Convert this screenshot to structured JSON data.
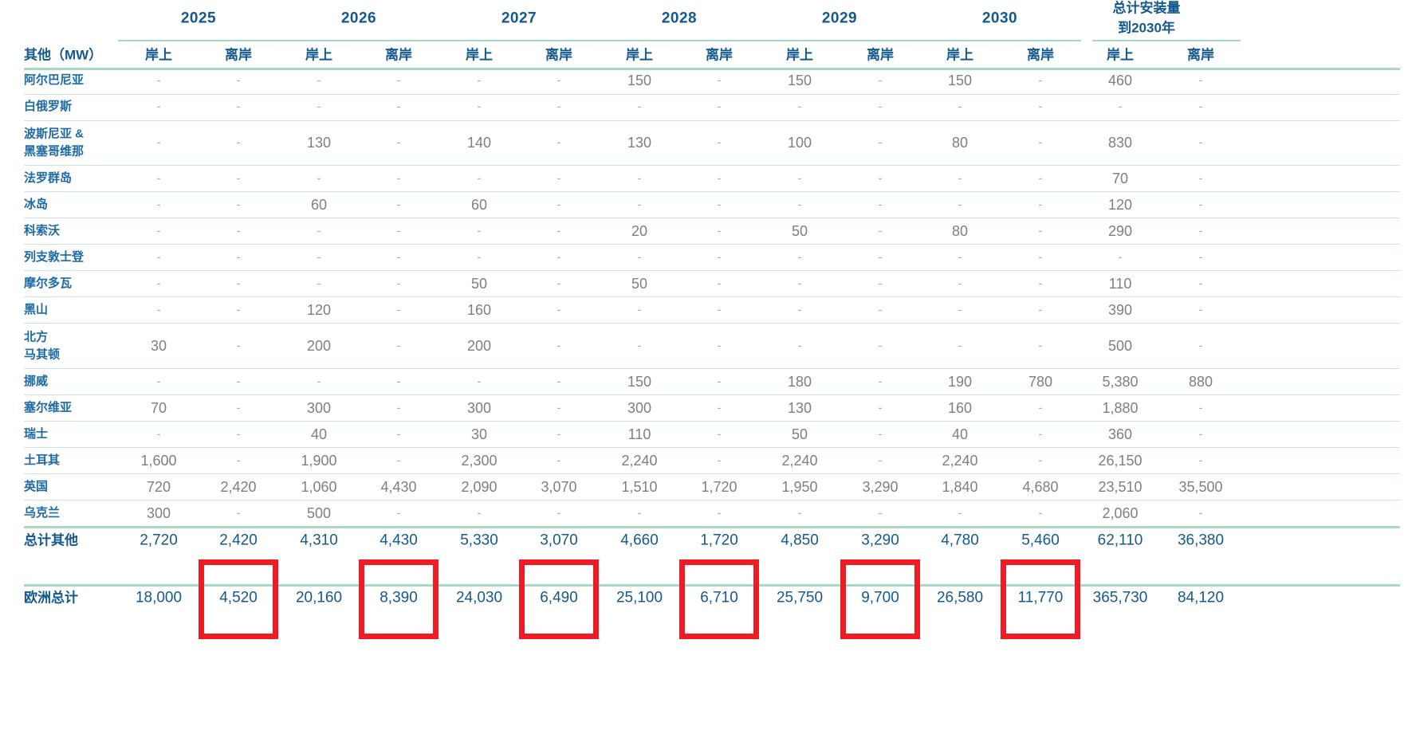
{
  "years": [
    "2025",
    "2026",
    "2027",
    "2028",
    "2029",
    "2030"
  ],
  "total_header": "总计安装量\n到2030年",
  "corner_label": "其他（MW）",
  "subheaders": [
    "岸上",
    "离岸",
    "岸上",
    "离岸",
    "岸上",
    "离岸",
    "岸上",
    "离岸",
    "岸上",
    "离岸",
    "岸上",
    "离岸",
    "岸上",
    "离岸"
  ],
  "rows": [
    {
      "label": "阿尔巴尼亚",
      "values": [
        "-",
        "-",
        "-",
        "-",
        "-",
        "-",
        "150",
        "-",
        "150",
        "-",
        "150",
        "-",
        "460",
        "-"
      ]
    },
    {
      "label": "白俄罗斯",
      "values": [
        "-",
        "-",
        "-",
        "-",
        "-",
        "-",
        "-",
        "-",
        "-",
        "-",
        "-",
        "-",
        "-",
        "-"
      ]
    },
    {
      "label": "波斯尼亚 &\n黑塞哥维那",
      "values": [
        "-",
        "-",
        "130",
        "-",
        "140",
        "-",
        "130",
        "-",
        "100",
        "-",
        "80",
        "-",
        "830",
        "-"
      ]
    },
    {
      "label": "法罗群岛",
      "values": [
        "-",
        "-",
        "-",
        "-",
        "-",
        "-",
        "-",
        "-",
        "-",
        "-",
        "-",
        "-",
        "70",
        "-"
      ]
    },
    {
      "label": "冰岛",
      "values": [
        "-",
        "-",
        "60",
        "-",
        "60",
        "-",
        "-",
        "-",
        "-",
        "-",
        "-",
        "-",
        "120",
        "-"
      ]
    },
    {
      "label": "科索沃",
      "values": [
        "-",
        "-",
        "-",
        "-",
        "-",
        "-",
        "20",
        "-",
        "50",
        "-",
        "80",
        "-",
        "290",
        "-"
      ]
    },
    {
      "label": "列支敦士登",
      "values": [
        "-",
        "-",
        "-",
        "-",
        "-",
        "-",
        "-",
        "-",
        "-",
        "-",
        "-",
        "-",
        "-",
        "-"
      ]
    },
    {
      "label": "摩尔多瓦",
      "values": [
        "-",
        "-",
        "-",
        "-",
        "50",
        "-",
        "50",
        "-",
        "-",
        "-",
        "-",
        "-",
        "110",
        "-"
      ]
    },
    {
      "label": "黑山",
      "values": [
        "-",
        "-",
        "120",
        "-",
        "160",
        "-",
        "-",
        "-",
        "-",
        "-",
        "-",
        "-",
        "390",
        "-"
      ]
    },
    {
      "label": "北方\n马其顿",
      "values": [
        "30",
        "-",
        "200",
        "-",
        "200",
        "-",
        "-",
        "-",
        "-",
        "-",
        "-",
        "-",
        "500",
        "-"
      ]
    },
    {
      "label": "挪威",
      "values": [
        "-",
        "-",
        "-",
        "-",
        "-",
        "-",
        "150",
        "-",
        "180",
        "-",
        "190",
        "780",
        "5,380",
        "880"
      ]
    },
    {
      "label": "塞尔维亚",
      "values": [
        "70",
        "-",
        "300",
        "-",
        "300",
        "-",
        "300",
        "-",
        "130",
        "-",
        "160",
        "-",
        "1,880",
        "-"
      ]
    },
    {
      "label": "瑞士",
      "values": [
        "-",
        "-",
        "40",
        "-",
        "30",
        "-",
        "110",
        "-",
        "50",
        "-",
        "40",
        "-",
        "360",
        "-"
      ]
    },
    {
      "label": "土耳其",
      "values": [
        "1,600",
        "-",
        "1,900",
        "-",
        "2,300",
        "-",
        "2,240",
        "-",
        "2,240",
        "-",
        "2,240",
        "-",
        "26,150",
        "-"
      ]
    },
    {
      "label": "英国",
      "values": [
        "720",
        "2,420",
        "1,060",
        "4,430",
        "2,090",
        "3,070",
        "1,510",
        "1,720",
        "1,950",
        "3,290",
        "1,840",
        "4,680",
        "23,510",
        "35,500"
      ]
    },
    {
      "label": "乌克兰",
      "values": [
        "300",
        "-",
        "500",
        "-",
        "-",
        "-",
        "-",
        "-",
        "-",
        "-",
        "-",
        "-",
        "2,060",
        "-"
      ]
    }
  ],
  "total_other": {
    "label": "总计其他",
    "values": [
      "2,720",
      "2,420",
      "4,310",
      "4,430",
      "5,330",
      "3,070",
      "4,660",
      "1,720",
      "4,850",
      "3,290",
      "4,780",
      "5,460",
      "62,110",
      "36,380"
    ]
  },
  "europe_total": {
    "label": "欧洲总计",
    "values": [
      "18,000",
      "4,520",
      "20,160",
      "8,390",
      "24,030",
      "6,490",
      "25,100",
      "6,710",
      "25,750",
      "9,700",
      "26,580",
      "11,770",
      "365,730",
      "84,120"
    ]
  },
  "highlighted_columns": [
    1,
    3,
    5,
    7,
    9,
    11
  ],
  "colors": {
    "header_blue": "#13598f",
    "label_blue": "#1b6aa6",
    "cell_grey": "#7c7f83",
    "rule_green": "#a9d8c5",
    "highlight_red": "#ee1c24"
  }
}
